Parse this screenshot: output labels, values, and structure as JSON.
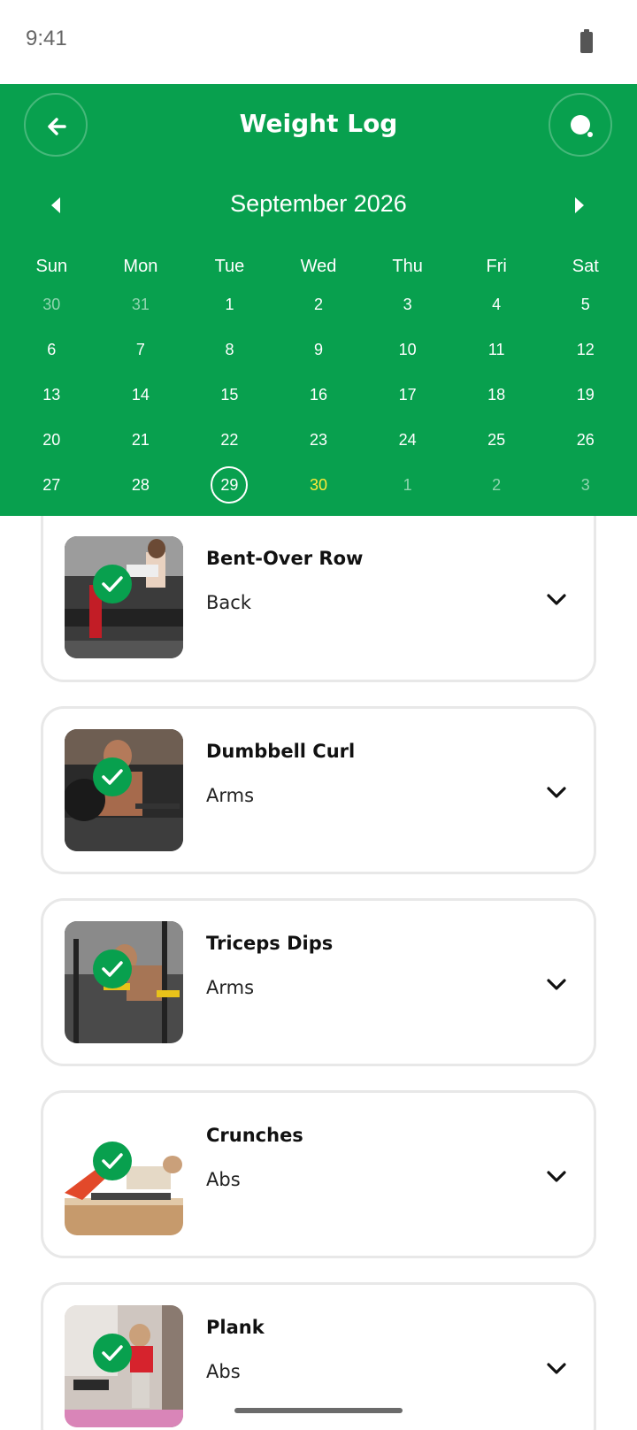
{
  "status_bar": {
    "time": "9:41"
  },
  "header": {
    "title": "Weight Log",
    "month_label": "September 2026",
    "accent_color": "#08a04e",
    "today_color": "#ffea3a"
  },
  "calendar": {
    "weekdays": [
      "Sun",
      "Mon",
      "Tue",
      "Wed",
      "Thu",
      "Fri",
      "Sat"
    ],
    "weeks": [
      [
        "30",
        "31",
        "1",
        "2",
        "3",
        "4",
        "5"
      ],
      [
        "6",
        "7",
        "8",
        "9",
        "10",
        "11",
        "12"
      ],
      [
        "13",
        "14",
        "15",
        "16",
        "17",
        "18",
        "19"
      ],
      [
        "20",
        "21",
        "22",
        "23",
        "24",
        "25",
        "26"
      ],
      [
        "27",
        "28",
        "29",
        "30",
        "1",
        "2",
        "3"
      ]
    ],
    "selected_day": "29",
    "today_day": "30"
  },
  "exercises": [
    {
      "name": "Bent-Over Row",
      "category": "Back",
      "completed": true
    },
    {
      "name": "Dumbbell Curl",
      "category": "Arms",
      "completed": true
    },
    {
      "name": "Triceps Dips",
      "category": "Arms",
      "completed": true
    },
    {
      "name": "Crunches",
      "category": "Abs",
      "completed": true
    },
    {
      "name": "Plank",
      "category": "Abs",
      "completed": true
    }
  ],
  "icons": {
    "back": "arrow-left-icon",
    "search": "search-icon",
    "prev": "caret-left-icon",
    "next": "caret-right-icon",
    "check": "check-icon",
    "expand": "chevron-down-icon"
  }
}
